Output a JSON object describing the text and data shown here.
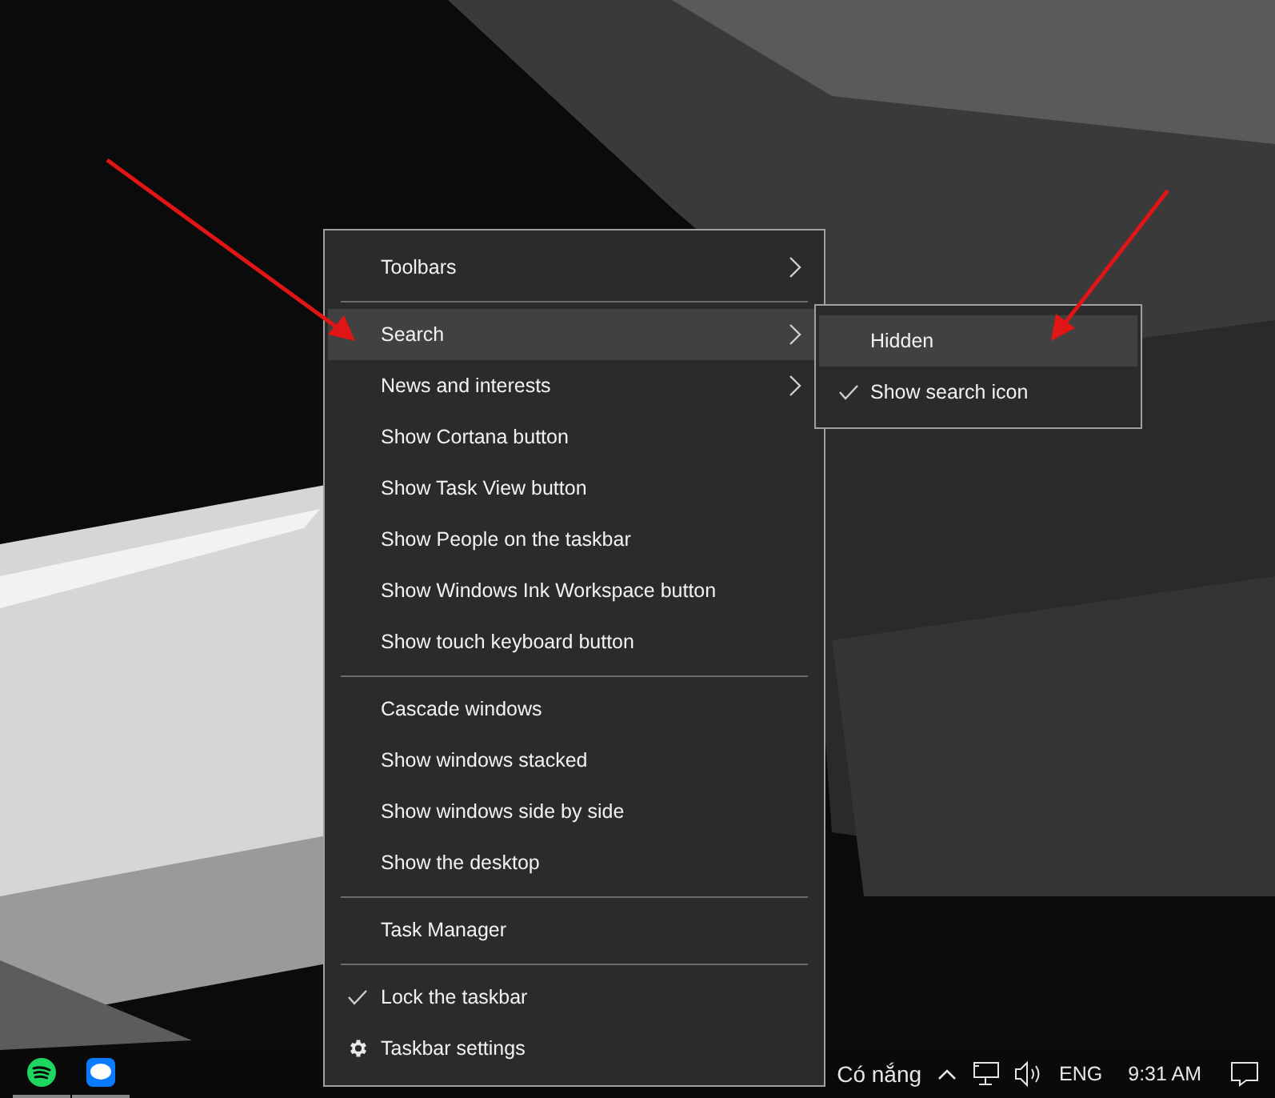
{
  "context_menu": {
    "items": [
      {
        "kind": "item",
        "label": "Toolbars",
        "selected": false,
        "checked": false,
        "submenu": true
      },
      {
        "kind": "separator"
      },
      {
        "kind": "item",
        "label": "Search",
        "selected": true,
        "checked": false,
        "submenu": true
      },
      {
        "kind": "item",
        "label": "News and interests",
        "selected": false,
        "checked": false,
        "submenu": true
      },
      {
        "kind": "item",
        "label": "Show Cortana button",
        "selected": false,
        "checked": false,
        "submenu": false
      },
      {
        "kind": "item",
        "label": "Show Task View button",
        "selected": false,
        "checked": false,
        "submenu": false
      },
      {
        "kind": "item",
        "label": "Show People on the taskbar",
        "selected": false,
        "checked": false,
        "submenu": false
      },
      {
        "kind": "item",
        "label": "Show Windows Ink Workspace button",
        "selected": false,
        "checked": false,
        "submenu": false
      },
      {
        "kind": "item",
        "label": "Show touch keyboard button",
        "selected": false,
        "checked": false,
        "submenu": false
      },
      {
        "kind": "separator"
      },
      {
        "kind": "item",
        "label": "Cascade windows",
        "selected": false,
        "checked": false,
        "submenu": false
      },
      {
        "kind": "item",
        "label": "Show windows stacked",
        "selected": false,
        "checked": false,
        "submenu": false
      },
      {
        "kind": "item",
        "label": "Show windows side by side",
        "selected": false,
        "checked": false,
        "submenu": false
      },
      {
        "kind": "item",
        "label": "Show the desktop",
        "selected": false,
        "checked": false,
        "submenu": false
      },
      {
        "kind": "separator"
      },
      {
        "kind": "item",
        "label": "Task Manager",
        "selected": false,
        "checked": false,
        "submenu": false
      },
      {
        "kind": "separator"
      },
      {
        "kind": "item",
        "label": "Lock the taskbar",
        "selected": false,
        "checked": true,
        "submenu": false
      },
      {
        "kind": "settings",
        "label": "Taskbar settings",
        "selected": false,
        "checked": false,
        "submenu": false
      }
    ]
  },
  "search_submenu": {
    "items": [
      {
        "label": "Hidden",
        "selected": true,
        "checked": false
      },
      {
        "label": "Show search icon",
        "selected": false,
        "checked": true
      }
    ]
  },
  "taskbar": {
    "weather": "Có nắng",
    "language": "ENG",
    "time": "9:31 AM"
  }
}
